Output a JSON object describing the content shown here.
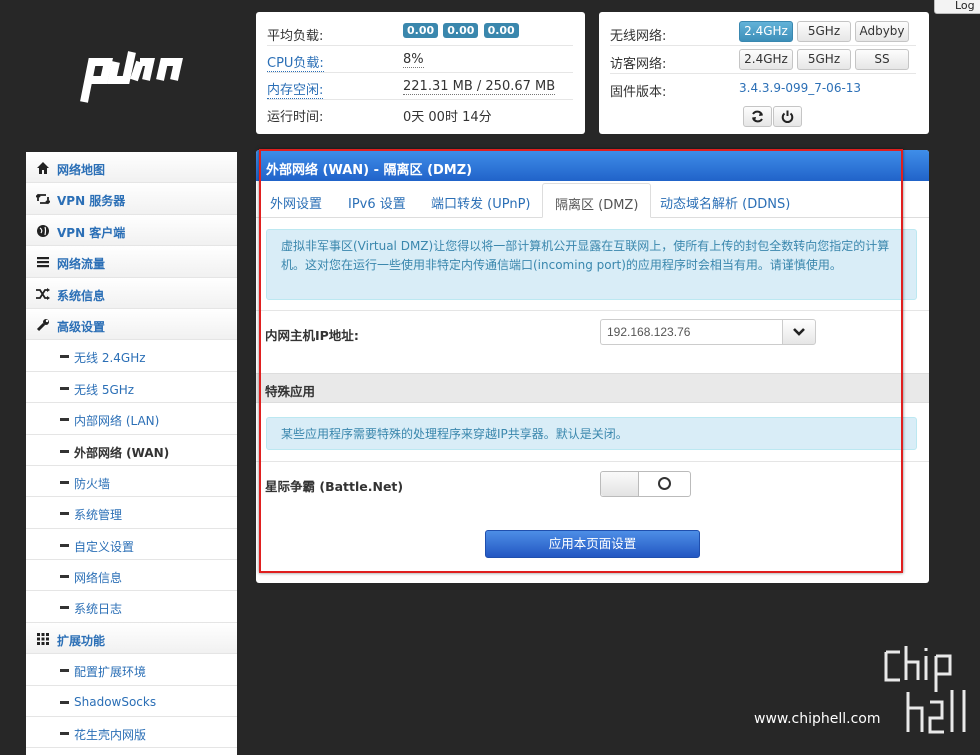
{
  "top_button": {
    "label": "Log"
  },
  "status": {
    "cpu_avg_label": "平均负载:",
    "load_values": [
      "0.00",
      "0.00",
      "0.00"
    ],
    "cpu_label": "CPU负载:",
    "cpu_value": "8%",
    "mem_label": "内存空闲:",
    "mem_value": "221.31 MB / 250.67 MB",
    "uptime_label": "运行时间:",
    "uptime_value": "0天 00时 14分"
  },
  "wireless": {
    "wifi_label": "无线网络:",
    "wifi_buttons": [
      "2.4GHz",
      "5GHz",
      "Adbyby"
    ],
    "guest_label": "访客网络:",
    "guest_buttons": [
      "2.4GHz",
      "5GHz",
      "SS"
    ],
    "fw_label": "固件版本:",
    "fw_value": "3.4.3.9-099_7-06-13"
  },
  "sidebar": {
    "items": [
      {
        "label": "网络地图",
        "icon": "home-icon"
      },
      {
        "label": "VPN 服务器",
        "icon": "retweet-icon"
      },
      {
        "label": "VPN 客户端",
        "icon": "globe-icon"
      },
      {
        "label": "网络流量",
        "icon": "list-icon"
      },
      {
        "label": "系统信息",
        "icon": "shuffle-icon"
      },
      {
        "label": "高级设置",
        "icon": "wrench-icon"
      }
    ],
    "sub_items": [
      {
        "label": "无线 2.4GHz"
      },
      {
        "label": "无线 5GHz"
      },
      {
        "label": "内部网络 (LAN)"
      },
      {
        "label": "外部网络 (WAN)"
      },
      {
        "label": "防火墙"
      },
      {
        "label": "系统管理"
      },
      {
        "label": "自定义设置"
      },
      {
        "label": "网络信息"
      },
      {
        "label": "系统日志"
      }
    ],
    "ext_label": "扩展功能",
    "ext_items": [
      {
        "label": "配置扩展环境"
      },
      {
        "label": "ShadowSocks"
      },
      {
        "label": "花生壳内网版"
      }
    ]
  },
  "main": {
    "title": "外部网络 (WAN) - 隔离区 (DMZ)",
    "tabs": [
      "外网设置",
      "IPv6 设置",
      "端口转发 (UPnP)",
      "隔离区 (DMZ)",
      "动态域名解析 (DDNS)"
    ],
    "dmz_info": "虚拟非军事区(Virtual DMZ)让您得以将一部计算机公开显露在互联网上，使所有上传的封包全数转向您指定的计算机。这对您在运行一些使用非特定内传通信端口(incoming port)的应用程序时会相当有用。请谨慎使用。",
    "host_ip_label": "内网主机IP地址:",
    "host_ip_value": "192.168.123.76",
    "special_title": "特殊应用",
    "special_info": "某些应用程序需要特殊的处理程序来穿越IP共享器。默认是关闭。",
    "battlenet_label": "星际争霸 (Battle.Net)",
    "battlenet_enabled": false,
    "apply_label": "应用本页面设置"
  },
  "watermark": {
    "text": "www.chiphell.com"
  }
}
